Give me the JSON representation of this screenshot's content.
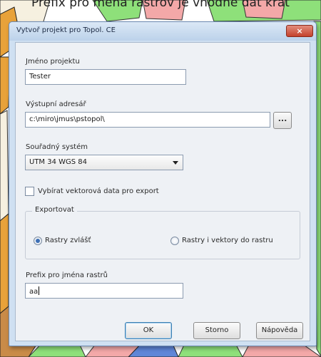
{
  "caption": "Prefix pro měna rastrov je vhodné dát krát",
  "dialog": {
    "title": "Vytvoř projekt pro Topol. CE",
    "close_label": "×",
    "project_name": {
      "label": "Jméno projektu",
      "value": "Tester"
    },
    "output_address": {
      "label": "Výstupní adresář",
      "value": "c:\\miro\\jmus\\pstopol\\",
      "browse_label": "..."
    },
    "coordinate_system": {
      "label": "Souřadný systém",
      "selected": "UTM 34 WGS 84"
    },
    "vector_export": {
      "label": "Vybírat vektorová data pro export",
      "checked": false
    },
    "export_group": {
      "legend": "Exportovat",
      "options": [
        {
          "label": "Rastry zvlášť",
          "checked": true
        },
        {
          "label": "Rastry i vektory do rastru",
          "checked": false
        }
      ]
    },
    "raster_prefix": {
      "label": "Prefix pro jména rastrů",
      "value": "aa"
    },
    "buttons": {
      "ok": "OK",
      "cancel": "Storno",
      "help": "Nápověda"
    }
  },
  "colors": {
    "title_bar": "#bcd2ea",
    "dialog_frame": "#cfe0f2",
    "close_button": "#c4422c",
    "map_green": "#8ee07a",
    "map_pink": "#f3a8a8",
    "map_orange": "#e8a23a",
    "map_blue": "#5f86d8"
  }
}
